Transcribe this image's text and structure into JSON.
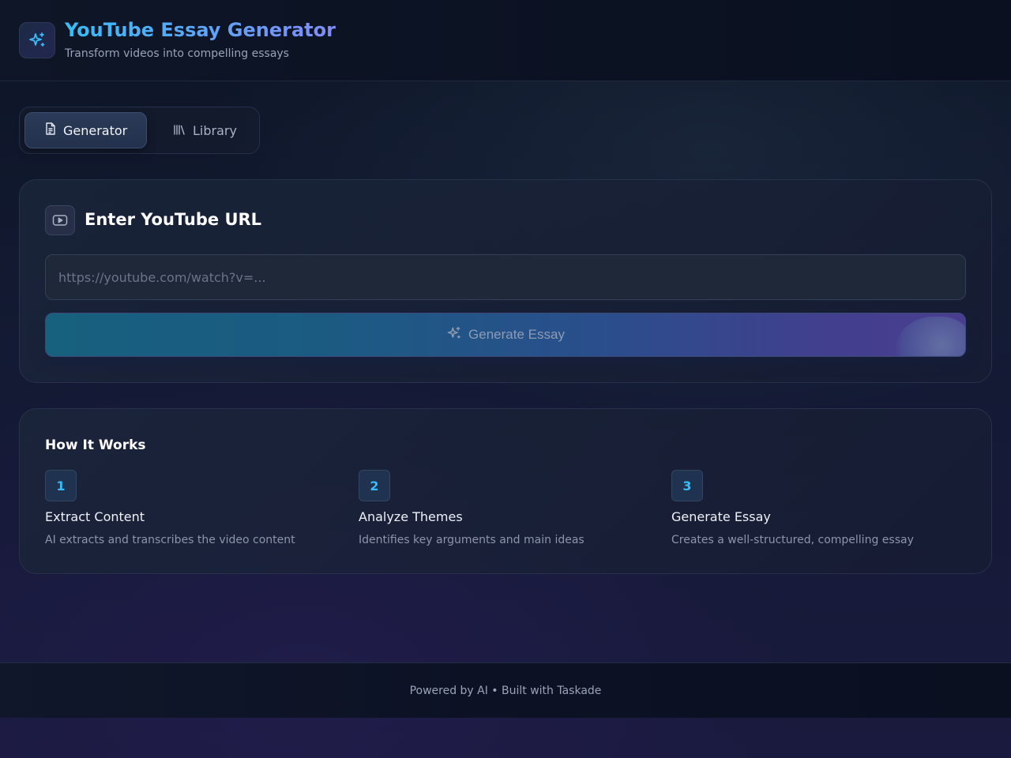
{
  "header": {
    "title": "YouTube Essay Generator",
    "subtitle": "Transform videos into compelling essays",
    "logo_icon": "sparkles-icon"
  },
  "tabs": [
    {
      "label": "Generator",
      "icon": "document-icon",
      "active": true
    },
    {
      "label": "Library",
      "icon": "library-icon",
      "active": false
    }
  ],
  "url_card": {
    "icon": "youtube-icon",
    "heading": "Enter YouTube URL",
    "input_value": "",
    "input_placeholder": "https://youtube.com/watch?v=...",
    "button_label": "Generate Essay",
    "button_icon": "sparkles-icon"
  },
  "how_it_works": {
    "title": "How It Works",
    "steps": [
      {
        "number": "1",
        "title": "Extract Content",
        "description": "AI extracts and transcribes the video content"
      },
      {
        "number": "2",
        "title": "Analyze Themes",
        "description": "Identifies key arguments and main ideas"
      },
      {
        "number": "3",
        "title": "Generate Essay",
        "description": "Creates a well-structured, compelling essay"
      }
    ]
  },
  "footer": {
    "text": "Powered by AI • Built with Taskade"
  },
  "colors": {
    "accent_cyan": "#38bdf8",
    "accent_indigo": "#818cf8",
    "background": "#131a33"
  }
}
